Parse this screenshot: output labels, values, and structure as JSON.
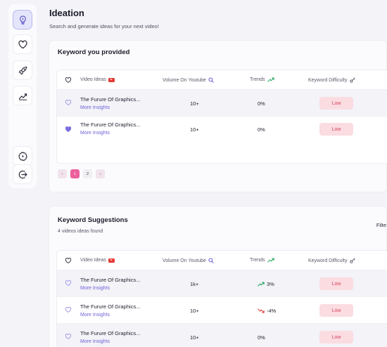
{
  "sidebar": {
    "items": [
      {
        "name": "ideation",
        "icon": "lightbulb-icon",
        "active": true
      },
      {
        "name": "favorites",
        "icon": "heart-icon",
        "active": false
      },
      {
        "name": "launch",
        "icon": "rocket-icon",
        "active": false
      },
      {
        "name": "analytics",
        "icon": "trend-chart-icon",
        "active": false
      }
    ],
    "bottom": [
      {
        "name": "settings",
        "icon": "settings-icon"
      },
      {
        "name": "logout",
        "icon": "logout-icon"
      }
    ]
  },
  "header": {
    "title": "Ideation",
    "subtitle": "Search and generate ideas for your next video!"
  },
  "provided": {
    "title": "Keyword you provided",
    "columns": {
      "ideas": "Video Ideas",
      "volume": "Volume On Youtube",
      "trends": "Trends",
      "difficulty": "Keyword Difficulty"
    },
    "rows": [
      {
        "title": "The Furure Of Graphics...",
        "insight": "More Insights",
        "volume": "10+",
        "trend": "0%",
        "difficulty": "Low",
        "liked": false
      },
      {
        "title": "The Furure Of Graphics...",
        "insight": "More Insights",
        "volume": "10+",
        "trend": "0%",
        "difficulty": "Low",
        "liked": true
      }
    ],
    "pagination": {
      "prev": "‹",
      "pages": [
        "1",
        "2"
      ],
      "next": "›",
      "current": "1"
    }
  },
  "suggestions": {
    "title": "Keyword Suggestions",
    "subtitle": "4 videos ideas found",
    "filter_label": "Filte",
    "columns": {
      "ideas": "Video Ideas",
      "volume": "Volume On Youtube",
      "trends": "Trends",
      "difficulty": "Keyword Difficulty"
    },
    "rows": [
      {
        "title": "The Furure Of Graphics...",
        "insight": "More Insights",
        "volume": "1k+",
        "trend": "3%",
        "direction": "up",
        "difficulty": "Low"
      },
      {
        "title": "The Furure Of Graphics...",
        "insight": "More Insights",
        "volume": "10+",
        "trend": "-4%",
        "direction": "down",
        "difficulty": "Low"
      },
      {
        "title": "The Furure Of Graphics...",
        "insight": "More Insights",
        "volume": "10+",
        "trend": "0%",
        "direction": "flat",
        "difficulty": "Low"
      }
    ]
  },
  "colors": {
    "accent": "#6e63d6",
    "low_badge_bg": "#fadce1",
    "low_badge_text": "#d9465f",
    "trend_up": "#22a35a",
    "trend_down": "#e53935",
    "page_active": "#ec5f9b"
  }
}
